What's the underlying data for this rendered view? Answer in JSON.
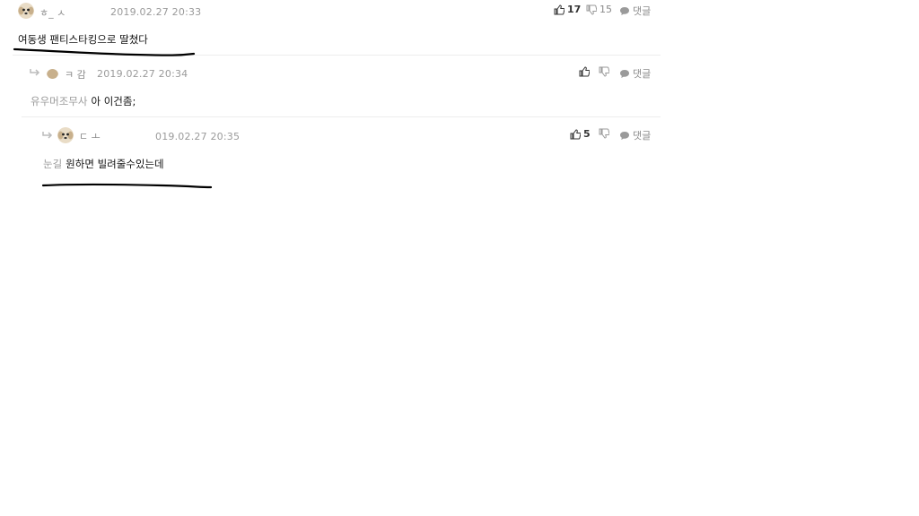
{
  "comments": [
    {
      "nickname": "ㅎ_ ㅅ",
      "timestamp": "2019.02.27 20:33",
      "body": "여동생 팬티스타킹으로 딸쳤다",
      "likes": "17",
      "dislikes": "15",
      "reply_label": "댓글"
    },
    {
      "nickname": "ㅋ 감",
      "timestamp": "2019.02.27 20:34",
      "mention": "유우머조무사",
      "body": "아 이건좀;",
      "likes": "",
      "dislikes": "",
      "reply_label": "댓글"
    },
    {
      "nickname": "ㄷ ㅗ",
      "timestamp": "019.02.27 20:35",
      "mention": "눈길",
      "body": "원하면 빌려줄수있는데",
      "likes": "5",
      "dislikes": "",
      "reply_label": "댓글"
    }
  ],
  "colors": {
    "text": "#111111",
    "meta": "#9a9a9a",
    "divider": "#ececec",
    "scribble": "#000000"
  },
  "icons": [
    "thumbs-up-icon",
    "thumbs-down-icon",
    "speech-bubble-icon",
    "reply-arrow-icon",
    "dog-avatar-icon"
  ]
}
